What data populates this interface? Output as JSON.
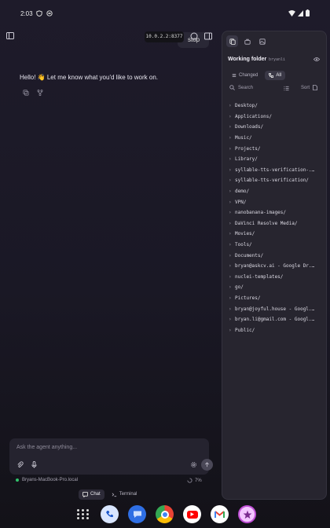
{
  "status_bar": {
    "time": "2:03"
  },
  "toolbar": {
    "url": "10.0.2.2:8377",
    "hidden_button": "stop"
  },
  "chat": {
    "greeting": "Hello! 👋 Let me know what you'd like to work on."
  },
  "composer": {
    "placeholder": "Ask the agent anything...",
    "host": "Bryans-MacBook-Pro.local",
    "cpu": "7%"
  },
  "mode_tabs": [
    {
      "label": "Chat",
      "active": true
    },
    {
      "label": "Terminal",
      "active": false
    }
  ],
  "panel": {
    "title": "Working folder",
    "user": "bryanli",
    "segments": [
      {
        "label": "Changed",
        "active": false
      },
      {
        "label": "All",
        "active": true
      }
    ],
    "search_label": "Search",
    "sort_label": "Sort",
    "entries": [
      "Desktop/",
      "Applications/",
      "Downloads/",
      "Music/",
      "Projects/",
      "Library/",
      "syllable-tts-verification-...",
      "syllable-tts-verification/",
      "demo/",
      "VPN/",
      "nanobanana-images/",
      "DaVinci Resolve Media/",
      "Movies/",
      "Tools/",
      "Documents/",
      "bryan@askcv.ai - Google Dr...",
      "nuclei-templates/",
      "go/",
      "Pictures/",
      "bryan@joyful.house - Googl...",
      "bryan.li@gmail.com - Googl...",
      "Public/"
    ]
  },
  "dock": {
    "apps": [
      "phone-icon",
      "messages-icon",
      "chrome-icon",
      "youtube-icon",
      "gmail-icon",
      "app-icon"
    ]
  },
  "colors": {
    "background": "#1e1b2a",
    "panel": "#27252f",
    "accent_green": "#31c36c"
  }
}
